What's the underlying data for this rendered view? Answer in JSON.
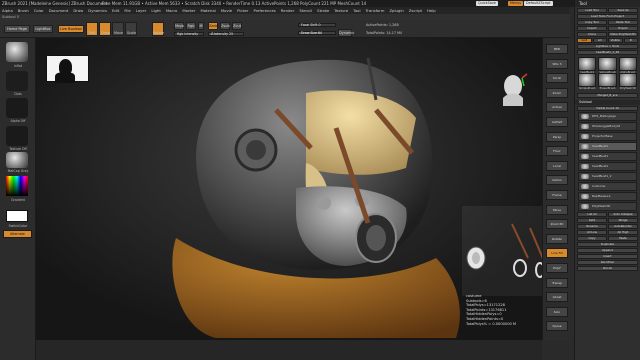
{
  "titlebar": {
    "title": "ZBrush 2021 [Madeleine Genesis] ZBrush Document",
    "stats": "Free Mem 11.91GB • Active Mem 5633 • Scratch Disk 3340 • RenderTime 0.13 ActivePoints 1,268 PolyCount 221 MP MeshCount 14",
    "quicksave": "QuickSave",
    "menus_label": "Menus",
    "script": "DefaultZScript"
  },
  "menubar": [
    "Alpha",
    "Brush",
    "Color",
    "Document",
    "Draw",
    "Dynamics",
    "Edit",
    "File",
    "Layer",
    "Light",
    "Macro",
    "Marker",
    "Material",
    "Movie",
    "Picker",
    "Preferences",
    "Render",
    "Stencil",
    "Stroke",
    "Texture",
    "Tool",
    "Transform",
    "Zplugin",
    "Zscript",
    "Help"
  ],
  "subtool_line": "Subtool 5",
  "toolbar": {
    "home": "Home Page",
    "lightbox": "LightBox",
    "live_boolean": "Live Boolean",
    "edit": "Edit",
    "draw": "Draw",
    "move": "Move",
    "scale": "Scale",
    "rotate": "Rotate",
    "mrgb": "Mrgb",
    "rgb": "Rgb",
    "m": "M",
    "zadd": "Zadd",
    "zsub": "Zsub",
    "zcut": "Zcut",
    "rgb_intensity": "Rgb Intensity",
    "z_intensity": "Z Intensity 25",
    "focal_shift": "Focal Shift 0",
    "draw_size": "Draw Size 64",
    "dynamic": "Dynamic",
    "active_points": "ActivePoints: 1,268",
    "total_points": "TotalPoints: 14.17 Mil"
  },
  "left_shelf": {
    "brush_label": "Inflat",
    "stroke_label": "Dots",
    "alpha_label": "Alpha Off",
    "texture_label": "Texture Off",
    "material_label": "MatCap Gray",
    "gradient_label": "Gradient",
    "switch_color": "SwitchColor",
    "alternate": "Alternate"
  },
  "viewport": {
    "stats_lines": [
      "costume",
      "Subtools=6",
      "TotalPolys=13171228",
      "TotalPoints=13176811",
      "TotalHiddenPolys=0",
      "TotalHiddenPoints=0",
      "TotalPolys% = 0.0000000 M"
    ]
  },
  "right_shelf": [
    "BPR",
    "SPix 3",
    "Scroll",
    "Zoom",
    "Actual",
    "AAHalf",
    "Persp",
    "Floor",
    "Local",
    "Gizmo",
    "Frame",
    "Move",
    "Zoom3D",
    "Rotate",
    "Line Fill",
    "PolyF",
    "Transp",
    "Ghost",
    "Solo",
    "Xpose"
  ],
  "tool_panel": {
    "header": "Tool",
    "rows": [
      [
        "Load Tool",
        "Save As"
      ],
      [
        "Load Tools From Project"
      ],
      [
        "Copy Tool",
        "Paste Tool"
      ],
      [
        "Import",
        "Export"
      ],
      [
        "Clone",
        "Make PolyMesh3D"
      ],
      [
        "GoZ",
        "All",
        "Visible",
        "R"
      ],
      [
        "Lightbox > Tools"
      ]
    ],
    "current_tool": "headBust1_2_48",
    "thumbs": [
      "headBust1",
      "SphereBrush",
      "AlphaBrush",
      "SimpleBrush",
      "EraserBrush",
      "PolyMesh3D"
    ],
    "merged": "Merged_B_sca",
    "subtool_header": "Subtool",
    "visible_count": "Visible Count 10",
    "subtools": [
      "RHS_PlatingAge",
      "WireGoggleBodySt",
      "ProjectorBase",
      "headBust1",
      "headBust1",
      "headBust1",
      "headBust1_2",
      "Costume",
      "RepMeasure",
      "PolyMesh3D"
    ],
    "bottom_rows": [
      [
        "List All",
        "Auto Collapse"
      ],
      [
        "Split",
        "Merge"
      ],
      [
        "Rename",
        "AutoReorder"
      ],
      [
        "All Low",
        "All High"
      ],
      [
        "Copy",
        "Paste"
      ],
      [
        "Duplicate"
      ],
      [
        "Append"
      ],
      [
        "Insert"
      ],
      [
        "Del Other"
      ],
      [
        "Del All"
      ]
    ]
  }
}
